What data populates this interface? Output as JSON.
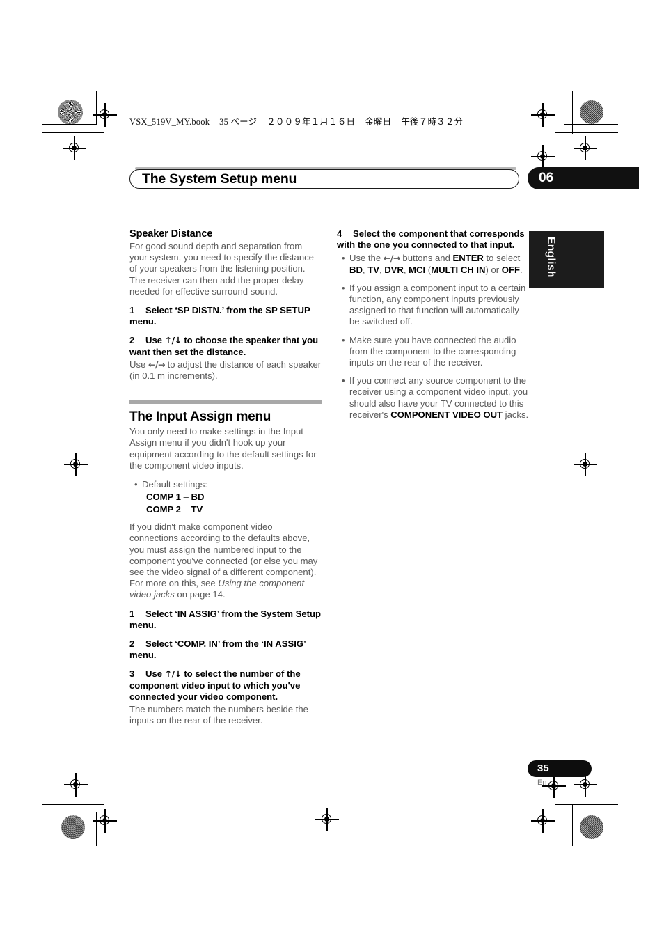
{
  "book_header": {
    "filename": "VSX_519V_MY.book",
    "page_label": "35 ページ",
    "date": "２００９年１月１６日",
    "weekday": "金曜日",
    "time": "午後７時３２分"
  },
  "header": {
    "title": "The System Setup menu",
    "chapter": "06"
  },
  "language_tab": {
    "label": "English"
  },
  "left_column": {
    "speaker_distance": {
      "heading": "Speaker Distance",
      "intro": "For good sound depth and separation from your system, you need to specify the distance of your speakers from the listening position. The receiver can then add the proper delay needed for effective surround sound.",
      "step1_num": "1",
      "step1_text": "Select ‘SP DISTN.’ from the SP SETUP menu.",
      "step2_num": "2",
      "step2_text_a": "Use ",
      "step2_arrows": "↑/↓",
      "step2_text_b": " to choose the speaker that you want then set the distance.",
      "step2_body_a": "Use ",
      "step2_body_arrows": "←/→",
      "step2_body_b": " to adjust the distance of each speaker (in 0.1 m increments)."
    },
    "input_assign": {
      "heading": "The Input Assign menu",
      "intro": "You only need to make settings in the Input Assign menu if you didn't hook up your equipment according to the default settings for the component video inputs.",
      "bullet_default": "Default settings:",
      "defaults": [
        {
          "name": "COMP 1",
          "dash": " – ",
          "value": "BD"
        },
        {
          "name": "COMP 2",
          "dash": " – ",
          "value": "TV"
        }
      ],
      "para_a": "If you didn't make component video connections according to the defaults above, you must assign the numbered input to the component you've connected (or else you may see the video signal of a different component). For more on this, see ",
      "para_italic": "Using the component video jacks",
      "para_b": " on page 14.",
      "step1_num": "1",
      "step1_text": "Select ‘IN ASSIG’ from the System Setup menu.",
      "step2_num": "2",
      "step2_text": "Select ‘COMP. IN’ from the ‘IN ASSIG’ menu.",
      "step3_num": "3",
      "step3_text_a": "Use ",
      "step3_arrows": "↑/↓",
      "step3_text_b": " to select the number of the component video input to which you've connected your video component.",
      "step3_body": "The numbers match the numbers beside the inputs on the rear of the receiver."
    }
  },
  "right_column": {
    "step4_num": "4",
    "step4_text": "Select the component that corresponds with the one you connected to that input.",
    "bullet1": {
      "a": "Use the ",
      "arrows": "←/→",
      "b": " buttons and ",
      "enter": "ENTER",
      "c": " to select ",
      "bd": "BD",
      "sep1": ", ",
      "tv": "TV",
      "sep2": ", ",
      "dvr": "DVR",
      "sep3": ", ",
      "mci": "MCI",
      "paren_open": " (",
      "multi": "MULTI CH IN",
      "paren_close": ") or ",
      "off": "OFF",
      "period": "."
    },
    "bullet2": "If you assign a component input to a certain function, any component inputs previously assigned to that function will automatically be switched off.",
    "bullet3": "Make sure you have connected the audio from the component to the corresponding inputs on the rear of the receiver.",
    "bullet4": {
      "a": "If you connect any source component to the receiver using a component video input, you should also have your TV connected to this receiver's ",
      "bold": "COMPONENT VIDEO OUT",
      "b": " jacks."
    }
  },
  "footer": {
    "page_number": "35",
    "page_language": "En"
  },
  "colors": {
    "body_text": "#595959",
    "heading_text": "#000000",
    "rule": "#a8a8a8",
    "tab_black": "#1c1c1c"
  }
}
